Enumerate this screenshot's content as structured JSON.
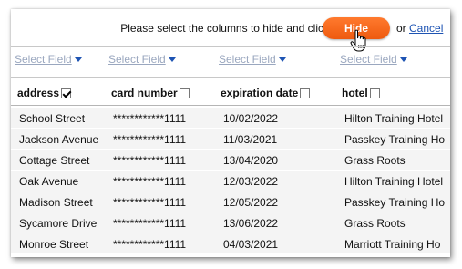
{
  "toolbar": {
    "prompt": "Please select the columns to hide and click",
    "hide_label": "Hide",
    "or_text": "or",
    "cancel_label": "Cancel",
    "hide_color": "#f26418"
  },
  "select_field_label": "Select Field",
  "columns": [
    {
      "label": "address",
      "checked": true
    },
    {
      "label": "card number",
      "checked": false
    },
    {
      "label": "expiration date",
      "checked": false
    },
    {
      "label": "hotel",
      "checked": false
    }
  ],
  "rows": [
    [
      "School Street",
      "************1111",
      "10/02/2022",
      "Hilton Training Hotel"
    ],
    [
      "Jackson Avenue",
      "************1111",
      "11/03/2021",
      "Passkey Training Ho"
    ],
    [
      "Cottage Street",
      "************1111",
      "13/04/2020",
      "Grass Roots"
    ],
    [
      "Oak Avenue",
      "************1111",
      "12/03/2022",
      "Hilton Training Hotel"
    ],
    [
      "Madison Street",
      "************1111",
      "12/05/2022",
      "Passkey Training Ho"
    ],
    [
      "Sycamore Drive",
      "************1111",
      "13/06/2022",
      "Grass Roots"
    ],
    [
      "Monroe Street",
      "************1111",
      "04/03/2021",
      "Marriott Training Ho"
    ]
  ]
}
